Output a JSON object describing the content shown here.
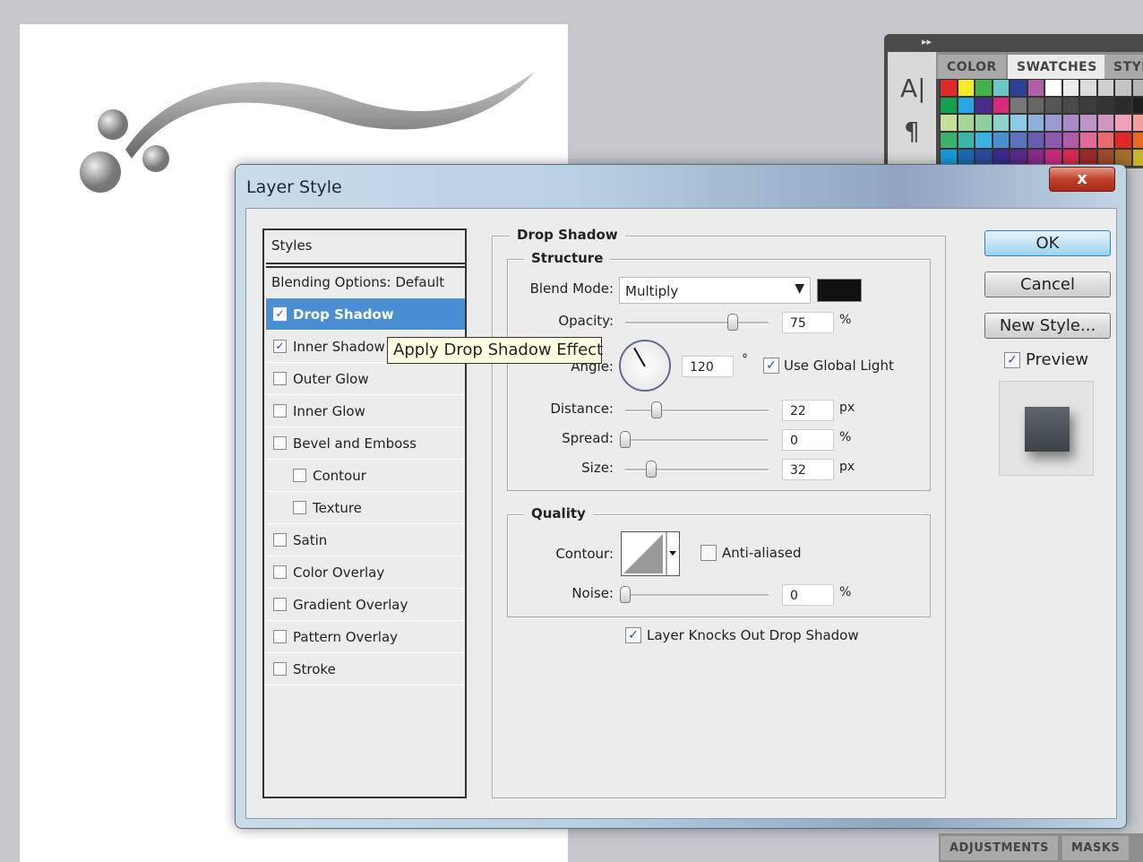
{
  "panel": {
    "tabs": [
      "COLOR",
      "SWATCHES",
      "STYL"
    ],
    "tools": [
      "A|",
      "¶"
    ],
    "swatches": [
      "#e02b2b",
      "#f4ea2a",
      "#3fb24a",
      "#6cc6c8",
      "#2e3f96",
      "#b35fa8",
      "#ffffff",
      "#ececec",
      "#dcdcdc",
      "#d0d0d0",
      "#c3c3c3",
      "#b5b5b5",
      "#17a04b",
      "#27a8e0",
      "#4a2a8c",
      "#d62a7a",
      "#777",
      "#666",
      "#555",
      "#4a4a4a",
      "#3d3d3d",
      "#333",
      "#2a2a2a",
      "#1e1e1e",
      "#c8df9a",
      "#a7d69a",
      "#8fcf9c",
      "#8fd0c8",
      "#8ccae8",
      "#8fb0db",
      "#9a9ad0",
      "#a88ac8",
      "#c094c8",
      "#d095c0",
      "#eea0b8",
      "#f4a09c",
      "#3eb06c",
      "#3cb4a8",
      "#3ab2e0",
      "#4a90d0",
      "#5a72c0",
      "#6a5cb0",
      "#8a5ab0",
      "#b05aa8",
      "#e06a98",
      "#e86a6a",
      "#e02828",
      "#e86a20",
      "#1a9ad8",
      "#1a6ab0",
      "#2a4a9a",
      "#3a2a8a",
      "#5a2a8a",
      "#8a2a8a",
      "#c82a7a",
      "#d82a50",
      "#a02a2a",
      "#a04a2a",
      "#a0702a",
      "#c8b42a"
    ]
  },
  "dialog": {
    "title": "Layer Style",
    "close": "x",
    "styles_header": "Styles",
    "blending": "Blending Options: Default",
    "styles": [
      {
        "label": "Drop Shadow",
        "checked": true,
        "selected": true,
        "sub": false
      },
      {
        "label": "Inner Shadow",
        "checked": true,
        "sub": false
      },
      {
        "label": "Outer Glow",
        "checked": false,
        "sub": false
      },
      {
        "label": "Inner Glow",
        "checked": false,
        "sub": false
      },
      {
        "label": "Bevel and Emboss",
        "checked": false,
        "sub": false
      },
      {
        "label": "Contour",
        "checked": false,
        "sub": true
      },
      {
        "label": "Texture",
        "checked": false,
        "sub": true
      },
      {
        "label": "Satin",
        "checked": false,
        "sub": false
      },
      {
        "label": "Color Overlay",
        "checked": false,
        "sub": false
      },
      {
        "label": "Gradient Overlay",
        "checked": false,
        "sub": false
      },
      {
        "label": "Pattern Overlay",
        "checked": false,
        "sub": false
      },
      {
        "label": "Stroke",
        "checked": false,
        "sub": false
      }
    ],
    "tooltip": "Apply Drop Shadow Effect",
    "section": "Drop Shadow",
    "structure": "Structure",
    "blend_mode": {
      "label": "Blend Mode:",
      "value": "Multiply",
      "color": "#111111"
    },
    "opacity": {
      "label": "Opacity:",
      "value": "75",
      "unit": "%",
      "fraction": 0.75
    },
    "angle": {
      "label": "Angle:",
      "value": "120",
      "unit": "°",
      "global": "Use Global Light"
    },
    "distance": {
      "label": "Distance:",
      "value": "22",
      "unit": "px"
    },
    "spread": {
      "label": "Spread:",
      "value": "0",
      "unit": "%"
    },
    "size": {
      "label": "Size:",
      "value": "32",
      "unit": "px"
    },
    "quality": "Quality",
    "contour": "Contour:",
    "anti_aliased": "Anti-aliased",
    "noise": {
      "label": "Noise:",
      "value": "0",
      "unit": "%"
    },
    "knockout": "Layer Knocks Out Drop Shadow",
    "buttons": {
      "ok": "OK",
      "cancel": "Cancel",
      "new_style": "New Style..."
    },
    "preview": "Preview"
  },
  "bottom_tabs": [
    "ADJUSTMENTS",
    "MASKS"
  ]
}
